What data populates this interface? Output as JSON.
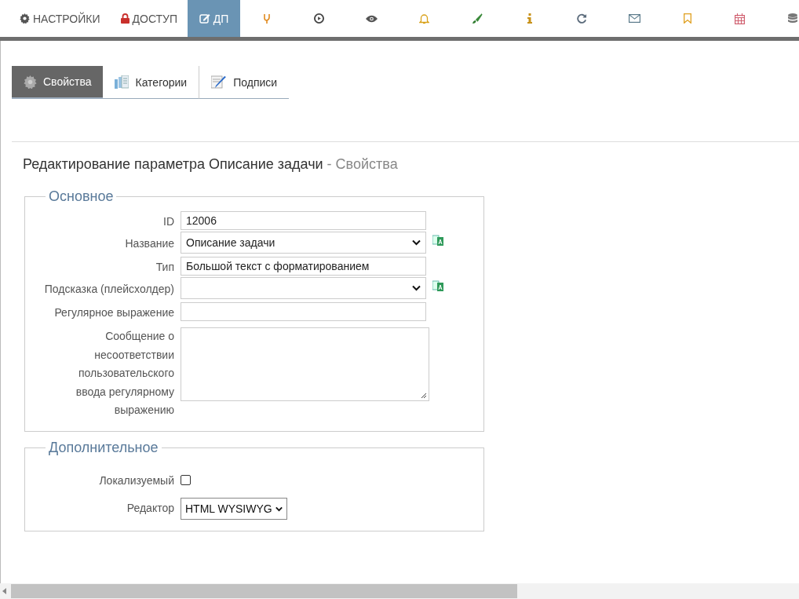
{
  "nav": [
    {
      "label": "НАСТРОЙКИ",
      "selected": false
    },
    {
      "label": "ДОСТУП",
      "selected": false
    },
    {
      "label": "ДП",
      "selected": true
    },
    {
      "selected": false
    },
    {
      "selected": false
    },
    {
      "selected": false
    },
    {
      "selected": false
    },
    {
      "selected": false
    },
    {
      "selected": false
    },
    {
      "selected": false
    },
    {
      "selected": false
    },
    {
      "selected": false
    },
    {
      "selected": false
    },
    {
      "selected": false
    }
  ],
  "tabs": [
    {
      "label": "Свойства",
      "selected": true
    },
    {
      "label": "Категории",
      "selected": false
    },
    {
      "label": "Подписи",
      "selected": false
    }
  ],
  "heading": {
    "title": "Редактирование параметра Описание задачи",
    "suffix": "- Свойства"
  },
  "sections": [
    {
      "legend": "Основное",
      "fields": [
        {
          "kind": "text",
          "label": "ID",
          "value": "12006",
          "translatable": false
        },
        {
          "kind": "select",
          "label": "Название",
          "value": "Описание задачи",
          "translatable": true
        },
        {
          "kind": "text",
          "label": "Тип",
          "value": "Большой текст с форматированием",
          "translatable": false
        },
        {
          "kind": "select",
          "label": "Подсказка (плейсхолдер)",
          "translatable": true
        },
        {
          "kind": "text",
          "label": "Регулярное выражение",
          "translatable": false
        },
        {
          "kind": "textarea",
          "label": "Сообщение о несоответствии пользовательского ввода регулярному выражению",
          "translatable": false
        }
      ]
    },
    {
      "legend": "Дополнительное",
      "fields": [
        {
          "kind": "checkbox",
          "label": "Локализуемый",
          "checked": false
        },
        {
          "kind": "dropdown",
          "label": "Редактор",
          "value": "HTML WYSIWYG"
        }
      ]
    }
  ]
}
